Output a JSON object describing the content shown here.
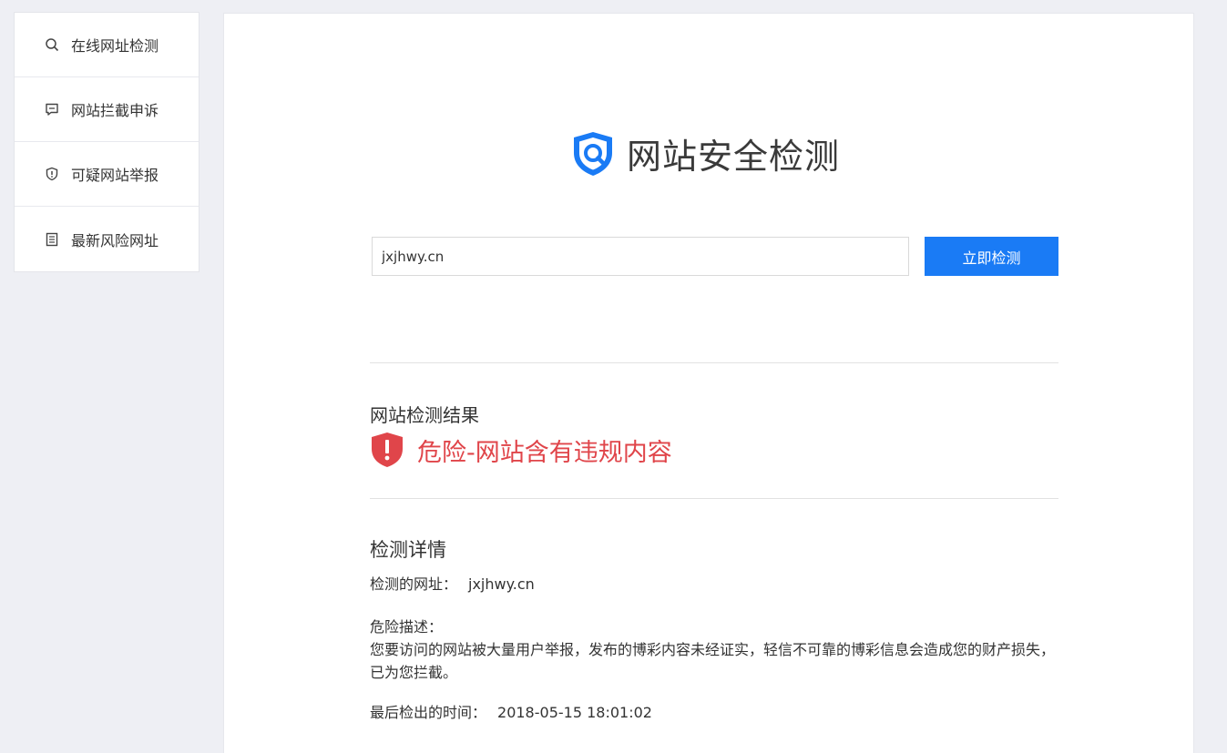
{
  "sidebar": {
    "items": [
      {
        "label": "在线网址检测",
        "icon": "search-icon"
      },
      {
        "label": "网站拦截申诉",
        "icon": "chat-icon"
      },
      {
        "label": "可疑网站举报",
        "icon": "shield-alert-icon"
      },
      {
        "label": "最新风险网址",
        "icon": "document-list-icon"
      }
    ]
  },
  "header": {
    "title": "网站安全检测",
    "logo_color": "#1a7bf5"
  },
  "search": {
    "value": "jxjhwy.cn",
    "button_label": "立即检测"
  },
  "result": {
    "heading": "网站检测结果",
    "status_text": "危险-网站含有违规内容",
    "status_color": "#e0454a"
  },
  "details": {
    "heading": "检测详情",
    "url_label": "检测的网址：",
    "url_value": "jxjhwy.cn",
    "desc_label": "危险描述：",
    "desc_text": "您要访问的网站被大量用户举报，发布的博彩内容未经证实，轻信不可靠的博彩信息会造成您的财产损失，已为您拦截。",
    "time_label": "最后检出的时间：",
    "time_value": "2018-05-15 18:01:02"
  }
}
